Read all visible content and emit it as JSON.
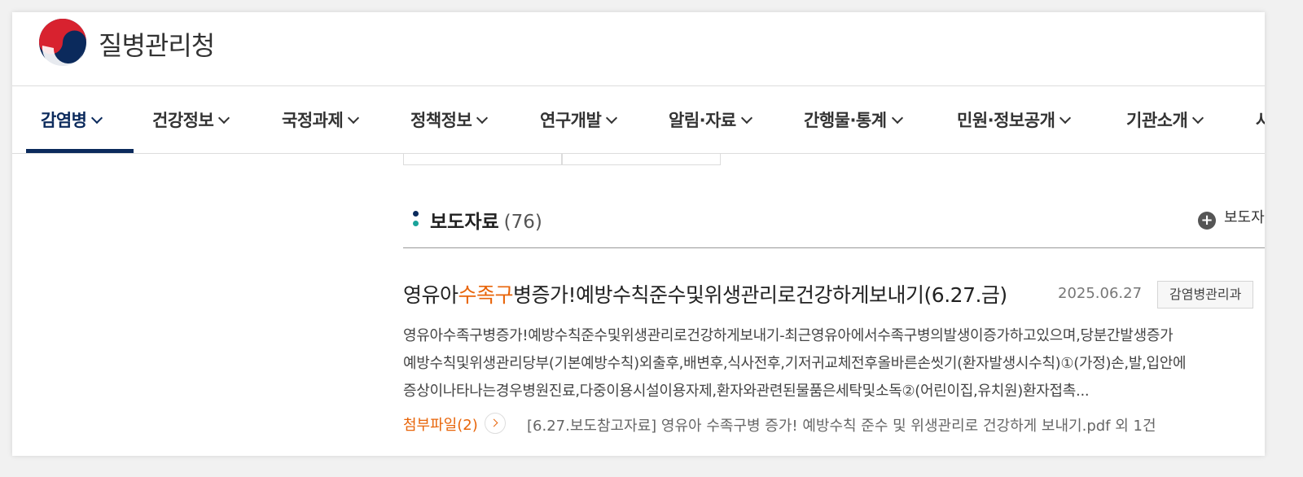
{
  "header": {
    "org_name": "질병관리청",
    "brand_colors": {
      "navy": "#0b2a5c",
      "red": "#d8222f",
      "accent": "#e8650a"
    }
  },
  "nav": {
    "items": [
      {
        "label": "감염병",
        "active": true
      },
      {
        "label": "건강정보"
      },
      {
        "label": "국정과제"
      },
      {
        "label": "정책정보"
      },
      {
        "label": "연구개발"
      },
      {
        "label": "알림·자료"
      },
      {
        "label": "간행물·통계"
      },
      {
        "label": "민원·정보공개"
      },
      {
        "label": "기관소개"
      },
      {
        "label": "사"
      }
    ]
  },
  "section": {
    "title": "보도자료",
    "count": "(76)",
    "more_label": "보도자"
  },
  "article": {
    "title_pre": "영유아",
    "title_highlight": "수족구",
    "title_post": "병증가!예방수칙준수및위생관리로건강하게보내기(6.27.금)",
    "date": "2025.06.27",
    "department": "감염병관리과",
    "summary_lines": [
      "영유아수족구병증가!예방수칙준수및위생관리로건강하게보내기-최근영유아에서수족구병의발생이증가하고있으며,당분간발생증가",
      "예방수칙및위생관리당부(기본예방수칙)외출후,배변후,식사전후,기저귀교체전후올바른손씻기(환자발생시수칙)①(가정)손,발,입안에",
      "증상이나타나는경우병원진료,다중이용시설이용자제,환자와관련된물품은세탁및소독②(어린이집,유치원)환자접촉..."
    ],
    "attachment_label": "첨부파일(2)",
    "attachment_file": "[6.27.보도참고자료] 영유아 수족구병 증가! 예방수칙 준수 및 위생관리로 건강하게 보내기.pdf 외 1건"
  }
}
